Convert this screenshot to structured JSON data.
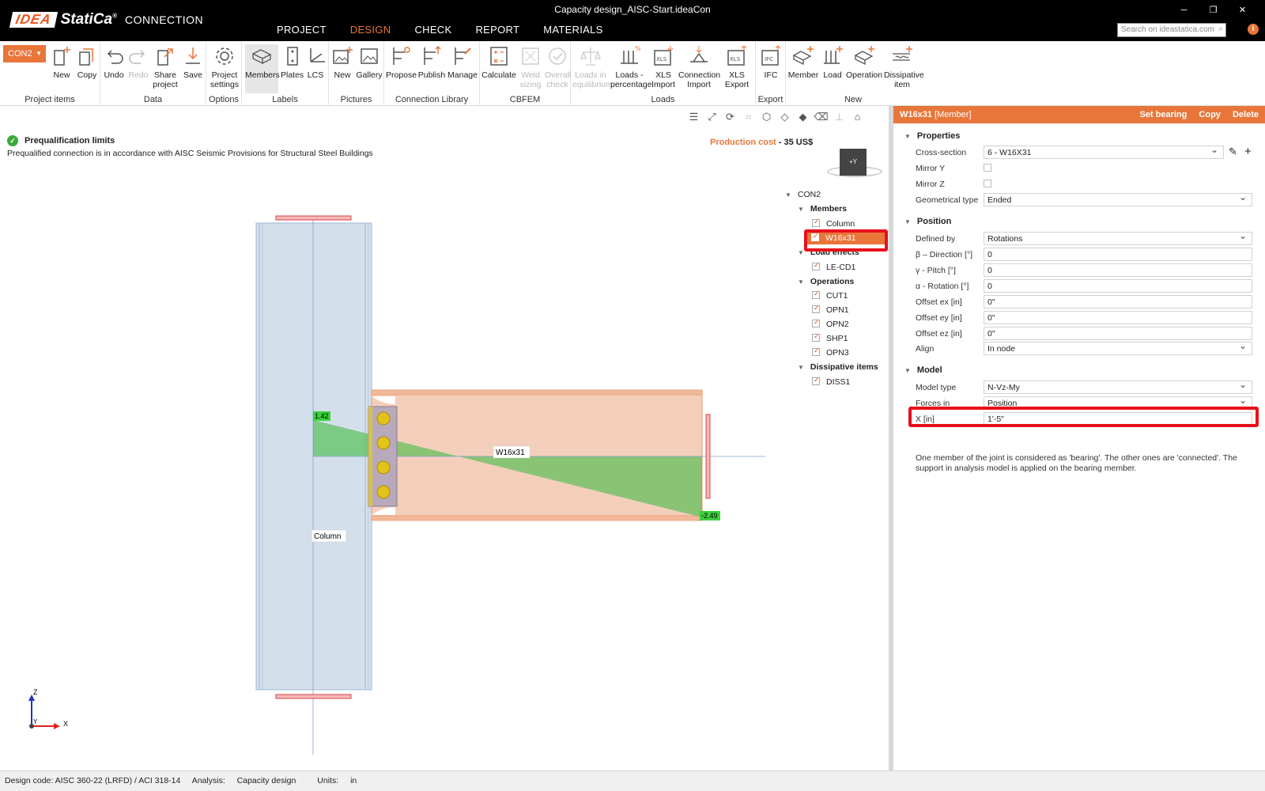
{
  "window": {
    "title": "Capacity design_AISC-Start.ideaCon"
  },
  "logo": {
    "idea": "IDEA",
    "statica": "StatiCa",
    "reg": "®",
    "product": "CONNECTION"
  },
  "main_tabs": [
    "PROJECT",
    "DESIGN",
    "CHECK",
    "REPORT",
    "MATERIALS"
  ],
  "search": {
    "placeholder": "Search on ideastatica.com"
  },
  "ribbon": {
    "connection_select": "CON2",
    "groups": {
      "project_items": "Project items",
      "data": "Data",
      "options": "Options",
      "labels": "Labels",
      "pictures": "Pictures",
      "connection_library": "Connection Library",
      "cbfem": "CBFEM",
      "loads": "Loads",
      "export": "Export",
      "new": "New"
    },
    "buttons": {
      "new": "New",
      "copy": "Copy",
      "undo": "Undo",
      "redo": "Redo",
      "share": "Share project",
      "save": "Save",
      "project_settings": "Project settings",
      "members": "Members",
      "plates": "Plates",
      "lcs": "LCS",
      "pic_new": "New",
      "gallery": "Gallery",
      "propose": "Propose",
      "publish": "Publish",
      "manage": "Manage",
      "calculate": "Calculate",
      "weld_sizing": "Weld sizing",
      "overall_check": "Overall check",
      "loads_equilibrium": "Loads in equilibrium",
      "loads_percentage": "Loads - percentage",
      "xls_import": "XLS Import",
      "connection_import": "Connection Import",
      "xls_export": "XLS Export",
      "ifc": "IFC",
      "member": "Member",
      "load": "Load",
      "operation": "Operation",
      "dissipative": "Dissipative item"
    }
  },
  "viewport": {
    "prequal_title": "Prequalification limits",
    "prequal_text": "Prequalified connection is in accordance with AISC Seismic Provisions for Structural Steel Buildings",
    "cost_label": "Production cost",
    "cost_value": "- 35 US$",
    "viewcube_label": "+Y",
    "beam_label": "W16x31",
    "column_label": "Column",
    "value_left": "1.42",
    "value_right": "-2.49",
    "axis_z": "Z",
    "axis_x": "X",
    "axis_y": "Y"
  },
  "tree": {
    "root": "CON2",
    "members_hdr": "Members",
    "members": [
      "Column",
      "W16x31"
    ],
    "load_effects_hdr": "Load effects",
    "load_effects": [
      "LE-CD1"
    ],
    "operations_hdr": "Operations",
    "operations": [
      "CUT1",
      "OPN1",
      "OPN2",
      "SHP1",
      "OPN3"
    ],
    "dissipative_hdr": "Dissipative items",
    "dissipative": [
      "DISS1"
    ]
  },
  "panel": {
    "title": "W16x31",
    "subtitle": "[Member]",
    "actions": [
      "Set bearing",
      "Copy",
      "Delete"
    ],
    "properties_hdr": "Properties",
    "cross_section_label": "Cross-section",
    "cross_section": "6 - W16X31",
    "mirror_y_label": "Mirror Y",
    "mirror_z_label": "Mirror Z",
    "geom_type_label": "Geometrical type",
    "geom_type": "Ended",
    "position_hdr": "Position",
    "defined_by_label": "Defined by",
    "defined_by": "Rotations",
    "direction_label": "β – Direction [°]",
    "direction": "0",
    "pitch_label": "γ - Pitch [°]",
    "pitch": "0",
    "rotation_label": "α - Rotation [°]",
    "rotation": "0",
    "offset_ex_label": "Offset ex [in]",
    "offset_ex": "0\"",
    "offset_ey_label": "Offset ey [in]",
    "offset_ey": "0\"",
    "offset_ez_label": "Offset ez [in]",
    "offset_ez": "0\"",
    "align_label": "Align",
    "align": "In node",
    "model_hdr": "Model",
    "model_type_label": "Model type",
    "model_type": "N-Vz-My",
    "forces_in_label": "Forces in",
    "forces_in": "Position",
    "x_label": "X [in]",
    "x_value": "1'-5\"",
    "note": "One member of the joint is considered as 'bearing'. The other ones are 'connected'. The support in analysis model is applied on the bearing member."
  },
  "status": {
    "design_code": "Design code: AISC 360-22 (LRFD) / ACI 318-14",
    "analysis_label": "Analysis:",
    "analysis": "Capacity design",
    "units_label": "Units:",
    "units": "in"
  }
}
